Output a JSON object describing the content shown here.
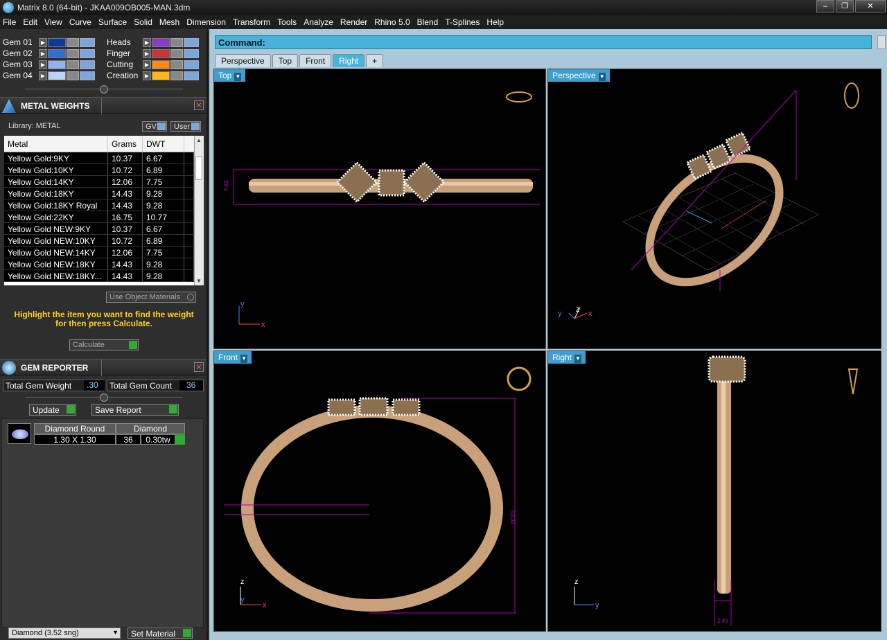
{
  "window": {
    "title": "Matrix 8.0 (64-bit) - JKAA009OB005-MAN.3dm",
    "minimize": "–",
    "maximize": "❐",
    "close": "✕"
  },
  "menu": [
    "File",
    "Edit",
    "View",
    "Curve",
    "Surface",
    "Solid",
    "Mesh",
    "Dimension",
    "Transform",
    "Tools",
    "Analyze",
    "Render",
    "Rhino 5.0",
    "Blend",
    "T-Splines",
    "Help"
  ],
  "layers_left": [
    {
      "name": "Gem 01",
      "color": "#0a3a9a"
    },
    {
      "name": "Gem 02",
      "color": "#2f6fd8"
    },
    {
      "name": "Gem 03",
      "color": "#8fb4f0"
    },
    {
      "name": "Gem 04",
      "color": "#bcd2f8"
    }
  ],
  "layers_right": [
    {
      "name": "Heads",
      "color": "#8a3ac8"
    },
    {
      "name": "Finger",
      "color": "#c8343a"
    },
    {
      "name": "Cutting",
      "color": "#ff8a14"
    },
    {
      "name": "Creation",
      "color": "#ffb814"
    }
  ],
  "metal_weights": {
    "title": "METAL WEIGHTS",
    "library_label": "Library: METAL",
    "gv_label": "GV",
    "user_label": "User",
    "columns": [
      "Metal",
      "Grams",
      "DWT"
    ],
    "rows": [
      [
        "Yellow Gold:9KY",
        "10.37",
        "6.67"
      ],
      [
        "Yellow Gold:10KY",
        "10.72",
        "6.89"
      ],
      [
        "Yellow Gold:14KY",
        "12.06",
        "7.75"
      ],
      [
        "Yellow Gold:18KY",
        "14.43",
        "9.28"
      ],
      [
        "Yellow Gold:18KY Royal",
        "14.43",
        "9.28"
      ],
      [
        "Yellow Gold:22KY",
        "16.75",
        "10.77"
      ],
      [
        "Yellow Gold NEW:9KY",
        "10.37",
        "6.67"
      ],
      [
        "Yellow Gold NEW:10KY",
        "10.72",
        "6.89"
      ],
      [
        "Yellow Gold NEW:14KY",
        "12.06",
        "7.75"
      ],
      [
        "Yellow Gold NEW:18KY",
        "14.43",
        "9.28"
      ],
      [
        "Yellow Gold NEW:18KY...",
        "14.43",
        "9.28"
      ]
    ],
    "use_object_materials": "Use Object Materials",
    "hint": "Highlight the item you want to find the weight for then press Calculate.",
    "calculate": "Calculate"
  },
  "gem_reporter": {
    "title": "GEM REPORTER",
    "total_weight_label": "Total Gem Weight",
    "total_weight_value": ".30",
    "total_count_label": "Total Gem Count",
    "total_count_value": "36",
    "update": "Update",
    "save_report": "Save Report",
    "gem_name": "Diamond Round",
    "gem_size": "1.30 X 1.30",
    "gem_material": "Diamond",
    "gem_count": "36",
    "gem_weight": "0.30tw"
  },
  "bottom": {
    "material_select": "Diamond     (3.52 sng)",
    "set_material": "Set Material"
  },
  "command_label": "Command:",
  "view_tabs": [
    "Perspective",
    "Top",
    "Front",
    "Right",
    "+"
  ],
  "viewports": {
    "top": {
      "label": "Top",
      "dim": "7.63"
    },
    "perspective": {
      "label": "Perspective"
    },
    "front": {
      "label": "Front",
      "dim": "53.31"
    },
    "right": {
      "label": "Right",
      "dim": "2.40"
    }
  },
  "axis": {
    "x": "x",
    "y": "y",
    "z": "z"
  }
}
